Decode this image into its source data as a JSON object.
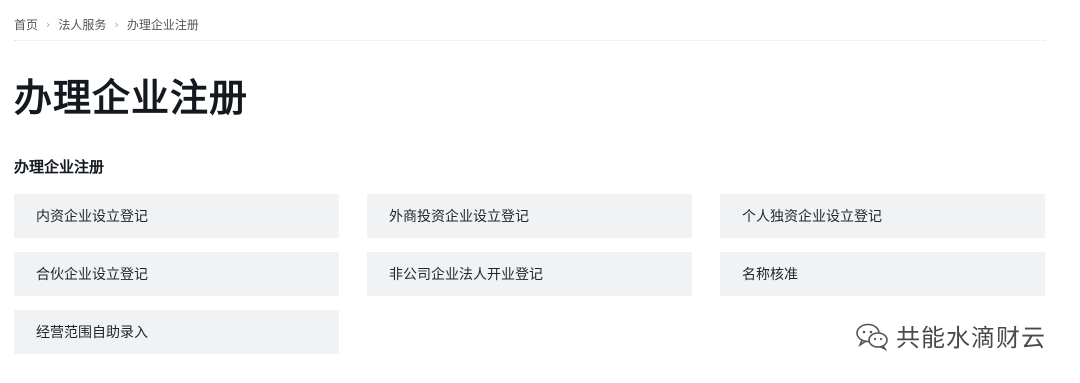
{
  "breadcrumb": {
    "items": [
      "首页",
      "法人服务",
      "办理企业注册"
    ],
    "separator": "›"
  },
  "page": {
    "title": "办理企业注册"
  },
  "section": {
    "title": "办理企业注册",
    "cards": [
      "内资企业设立登记",
      "外商投资企业设立登记",
      "个人独资企业设立登记",
      "合伙企业设立登记",
      "非公司企业法人开业登记",
      "名称核准",
      "经营范围自助录入"
    ]
  },
  "watermark": {
    "text": "共能水滴财云",
    "icon": "wechat-icon"
  }
}
